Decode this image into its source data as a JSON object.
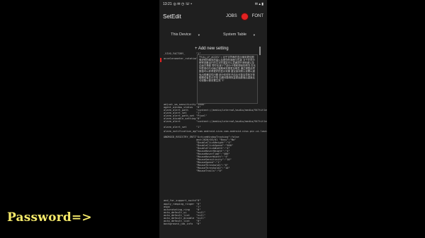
{
  "caption": "Password=>",
  "status": {
    "time": "13:21",
    "left_icons": "◎ ✉ ◷ ☏ •",
    "right_icons": "✉ ▴ ▮"
  },
  "appbar": {
    "title": "SetEdit",
    "jobs": "JOBS",
    "font": "FONT"
  },
  "selectors": {
    "device": "This Device",
    "table": "System Table"
  },
  "add_setting": "+ Add new setting",
  "editor_text": "\"FULL_LF_ACCEL\" = 对于字符串的显示使用更佳图像滤镜的缩放质量以及更快的速度与性能 对于在低分辨率设备运行的文字的渲染可以显著提升清晰度以及边缘平滑度 同时也减少了部分卡顿和掉帧的情况 在长列表滚动与动画过渡期间效果更加明显 通过调整此项数值可以获得更好的显示效果 建议保持默认设置以避免出现兼容性问题 部分机型在开启后可能会导致字体模糊或者显示异常 如遇问题请恢复原始数值后重新启动设备以使设置生效 \"1\"",
  "rows": [
    {
      "k": "_VIVO_FACTORY_",
      "v": "\"1\""
    },
    {
      "k": "accelerometer_rotation",
      "v": "\"1\""
    },
    {
      "k": "adjust_vm_sensitivity",
      "v": "\"3000\""
    },
    {
      "k": "agent_window_status",
      "v": "\"0\""
    },
    {
      "k": "alarm_alert_path",
      "v": "\"content://media/internal/audio/media/94?title=Pixel\""
    },
    {
      "k": "alarm_alert_set",
      "v": "\"1\""
    },
    {
      "k": "alarm_alert_path_set",
      "v": "\"Pixel\""
    },
    {
      "k": "alarm_disable_setting",
      "v": "\"0\""
    },
    {
      "k": "alarm_alert",
      "v": "\"content://media/internal/audio/media/94?title=Pixel&canonical=1\""
    },
    {
      "k": "alarm_alert_set",
      "v": "\"1\""
    },
    {
      "k": "alarm_notification_applied",
      "v": "\"com.android.vivo.com.android.vivo.pic.ui.launcher\""
    },
    {
      "k": "ANDROID_REGISTRY_ENTITY",
      "v": "\"ActiveWindowTracking\":false"
    },
    {
      "k": "and_for_support_switch",
      "v": "\"0\""
    },
    {
      "k": "apply_ramping_ringer",
      "v": "\"0\""
    },
    {
      "k": "aspo",
      "v": "\"1\""
    },
    {
      "k": "autorotating_ring",
      "v": "\"0\""
    },
    {
      "k": "auto_default_ui",
      "v": "\"null\""
    },
    {
      "k": "auto_default_list",
      "v": "\"null\""
    },
    {
      "k": "auto_default_disable",
      "v": "\"null\""
    },
    {
      "k": "auto_default_list",
      "v": "\"0\""
    },
    {
      "k": "background_job_info",
      "v": "\"0\""
    }
  ],
  "registry_lines": "and:2020/03/01 \"Busy\":\"No\"\n\"DoubleClickHeight\":\"4\"\n\"DoubleClickSpeed\":\"500\"\n\"DoubleClickWidth\":\"4\"\n\"MouseHoverHeight\":\"4\"\n\"MouseHoverTime\":\"400\"\n\"MouseHoverWidth\":\"4\"\n\"MouseSensitivity\":\"10\"\n\"MouseSpeed\":\"1\"\n\"MouseThreshold1\":\"6\"\n\"MouseThreshold2\":\"10\"\n\"MouseTrails\":\"0\""
}
